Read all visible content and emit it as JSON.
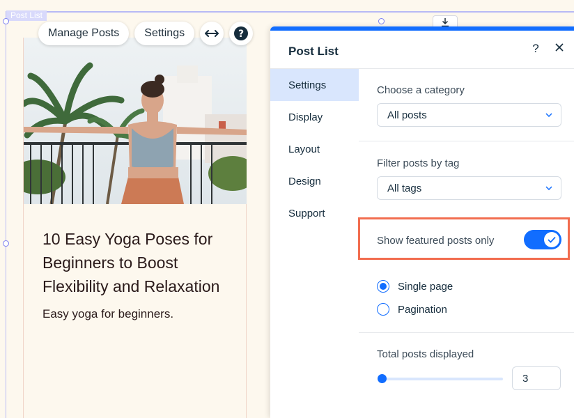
{
  "canvas": {
    "selection_tag": "Post List",
    "toolbar": {
      "manage_posts_label": "Manage Posts",
      "settings_label": "Settings",
      "stretch_icon": "horizontal-arrows-icon",
      "help_icon": "question-circle-icon"
    },
    "post": {
      "title": "10 Easy Yoga Poses for Beginners to Boost Flexibility and Relaxation",
      "excerpt": "Easy yoga for beginners."
    }
  },
  "panel": {
    "title": "Post List",
    "help_label": "?",
    "nav": [
      "Settings",
      "Display",
      "Layout",
      "Design",
      "Support"
    ],
    "active_nav": "Settings",
    "category": {
      "label": "Choose a category",
      "value": "All posts"
    },
    "tag_filter": {
      "label": "Filter posts by tag",
      "value": "All tags"
    },
    "featured": {
      "label": "Show featured posts only",
      "on": true
    },
    "pagination": {
      "options": [
        "Single page",
        "Pagination"
      ],
      "selected": "Single page"
    },
    "total_posts": {
      "label": "Total posts displayed",
      "value": "3"
    }
  },
  "colors": {
    "accent": "#116dff",
    "highlight": "#f26d4f",
    "canvas_bg": "#fdf8ee"
  }
}
